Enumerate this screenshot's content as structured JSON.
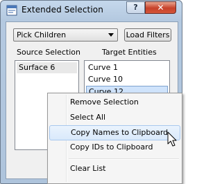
{
  "window": {
    "title": "Extended Selection"
  },
  "titlebar": {
    "help_label": "?",
    "close_label": "✕"
  },
  "toolbar": {
    "combo_value": "Pick Children",
    "load_filters_label": "Load Filters"
  },
  "source": {
    "heading": "Source Selection",
    "items": [
      "Surface 6"
    ]
  },
  "target": {
    "heading": "Target Entities",
    "items": [
      "Curve 1",
      "Curve 10",
      "Curve 12"
    ]
  },
  "context_menu": {
    "items": [
      "Remove Selection",
      "Select All",
      "Copy Names to Clipboard",
      "Copy IDs to Clipboard",
      "Clear List"
    ],
    "hovered_item": "Copy Names to Clipboard"
  },
  "colors": {
    "selection_active": "#cfe3fb",
    "close_button": "#c7412a",
    "titlebar": "#b4c9e0"
  }
}
